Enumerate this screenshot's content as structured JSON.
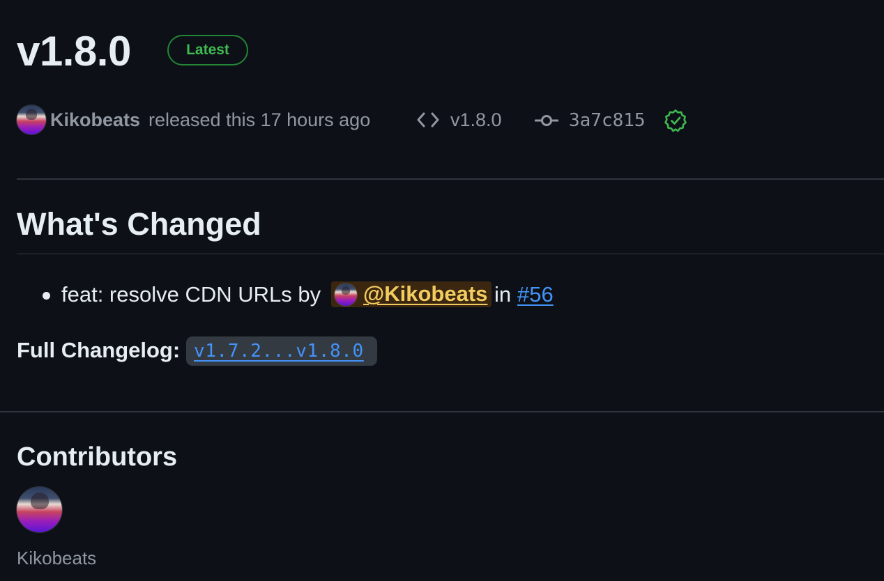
{
  "release": {
    "tag": "v1.8.0",
    "badge": "Latest",
    "author": "Kikobeats",
    "released_text": "released this 17 hours ago",
    "tag_ref": "v1.8.0",
    "commit": "3a7c815"
  },
  "whats_changed": {
    "heading": "What's Changed",
    "items": [
      {
        "text": "feat: resolve CDN URLs by",
        "mention": "@Kikobeats",
        "in_text": "in",
        "pr": "#56"
      }
    ]
  },
  "changelog": {
    "label": "Full Changelog:",
    "range": "v1.7.2...v1.8.0"
  },
  "contributors": {
    "heading": "Contributors",
    "people": [
      {
        "name": "Kikobeats"
      }
    ]
  },
  "colors": {
    "background": "#0d1117",
    "latest_green": "#3fb950",
    "link_blue": "#4493f8",
    "mention_yellow": "#f2cc60"
  },
  "icons": {
    "tag": "code-icon",
    "commit": "git-commit-icon",
    "verified": "verified-check-icon"
  }
}
